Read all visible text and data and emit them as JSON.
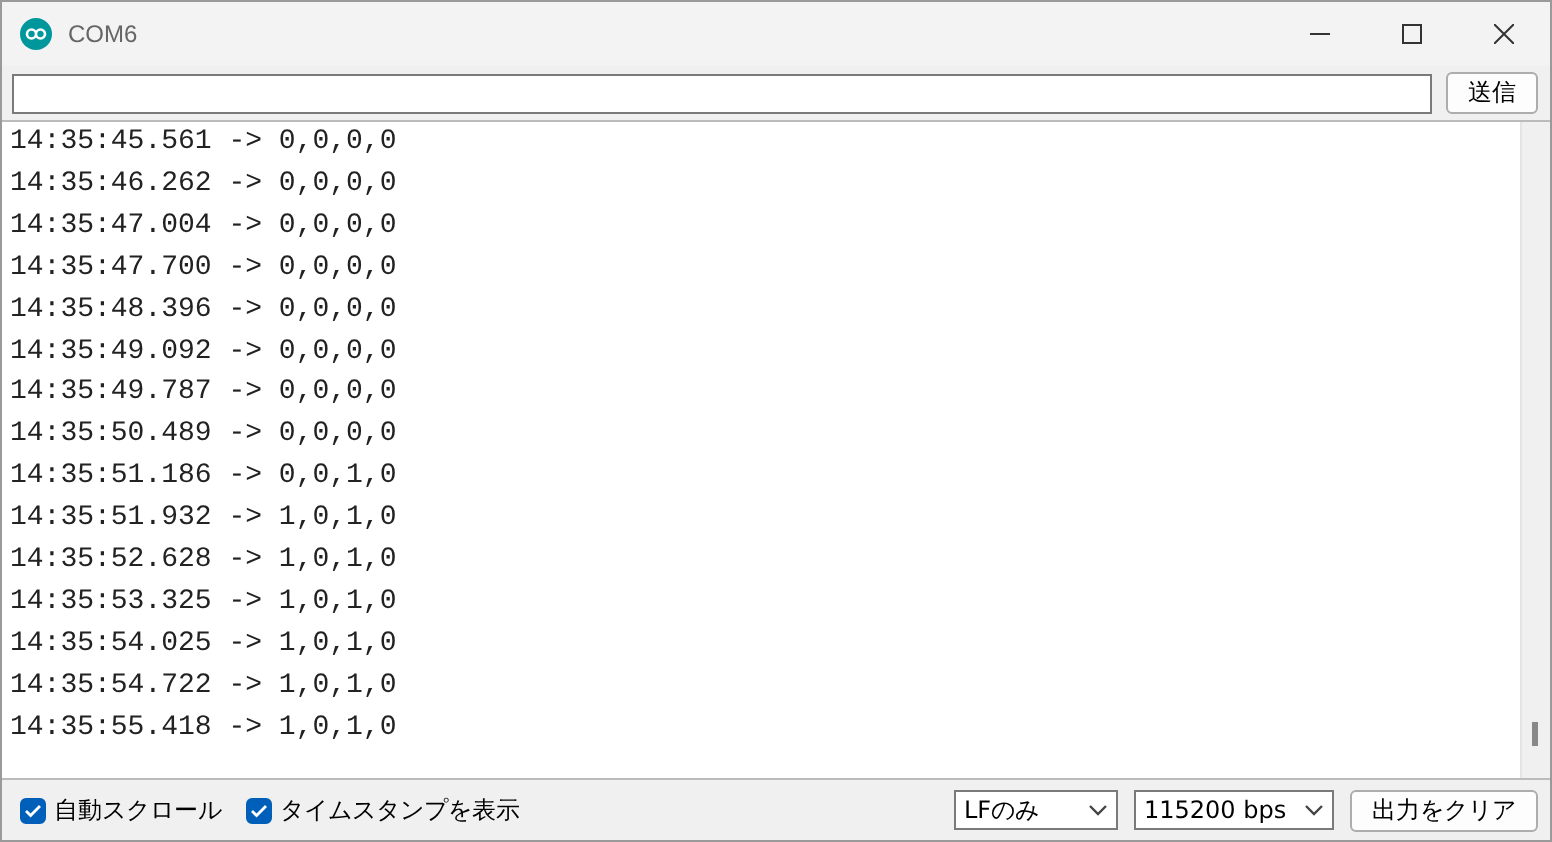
{
  "window": {
    "title": "COM6"
  },
  "send": {
    "button": "送信"
  },
  "output": [
    "14:35:45.561 -> 0,0,0,0",
    "14:35:46.262 -> 0,0,0,0",
    "14:35:47.004 -> 0,0,0,0",
    "14:35:47.700 -> 0,0,0,0",
    "14:35:48.396 -> 0,0,0,0",
    "14:35:49.092 -> 0,0,0,0",
    "14:35:49.787 -> 0,0,0,0",
    "14:35:50.489 -> 0,0,0,0",
    "14:35:51.186 -> 0,0,1,0",
    "14:35:51.932 -> 1,0,1,0",
    "14:35:52.628 -> 1,0,1,0",
    "14:35:53.325 -> 1,0,1,0",
    "14:35:54.025 -> 1,0,1,0",
    "14:35:54.722 -> 1,0,1,0",
    "14:35:55.418 -> 1,0,1,0"
  ],
  "options": [
    {
      "label": "自動スクロール",
      "checked": true
    },
    {
      "label": "タイムスタンプを表示",
      "checked": true
    }
  ],
  "line_ending": "LFのみ",
  "baud_rate": "115200 bps",
  "clear_button": "出力をクリア"
}
